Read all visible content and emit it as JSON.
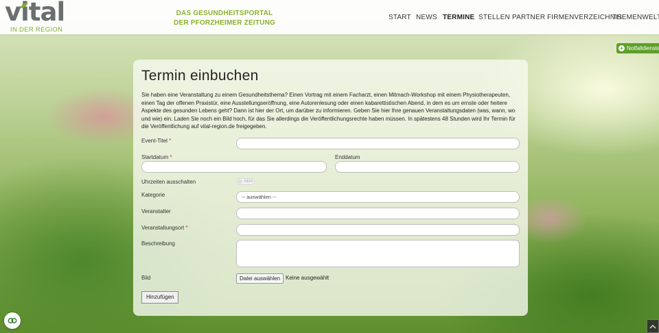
{
  "header": {
    "logo_word": "vital",
    "logo_sub": "IN DER REGION",
    "tagline_line1": "DAS GESUNDHEITSPORTAL",
    "tagline_line2": "DER PFORZHEIMER ZEITUNG",
    "nav": [
      "START",
      "NEWS",
      "TERMINE",
      "STELLEN",
      "PARTNER",
      "FIRMENVERZEICHNIS",
      "THEMENWELTEN"
    ],
    "active_nav": "TERMINE"
  },
  "notfall_label": "Notfalldienste",
  "form": {
    "title": "Termin einbuchen",
    "intro": "Sie haben eine Veranstaltung zu einem Gesundheitsthema? Einen Vortrag mit einem Facharzt, einen Mitmach-Workshop mit einem Physiotherapeuten, einen Tag der offenen Praxistür, eine Ausstellungseröffnung, eine Autorenlesung oder einen kabarettistischen Abend, in dem es um ernste oder heitere Aspekte des gesunden Lebens geht? Dann ist hier der Ort, um darüber zu informieren. Geben Sie hier Ihre genauen Veranstaltungsdaten (was, wann, wo und wie) ein. Laden Sie noch ein Bild hoch, für das Sie allerdings die Veröffentlichungsrechte haben müssen. In spätestens 48 Stunden wird Ihr Termin für die Veröffentlichung auf vital-region.de freigegeben.",
    "event_title_label": "Event-Titel",
    "start_label": "Startdatum",
    "end_label": "Enddatum",
    "times_off_label": "Uhrzeiten ausschalten",
    "toggle_text": "NEIN",
    "category_label": "Kategorie",
    "category_value": "-- auswählen --",
    "organizer_label": "Veranstalter",
    "location_label": "Veranstaltungsort",
    "description_label": "Beschreibung",
    "image_label": "Bild",
    "file_button": "Datei auswählen",
    "file_status": "Keine ausgewählt",
    "submit_label": "Hinzufügen",
    "required_mark": "*"
  }
}
